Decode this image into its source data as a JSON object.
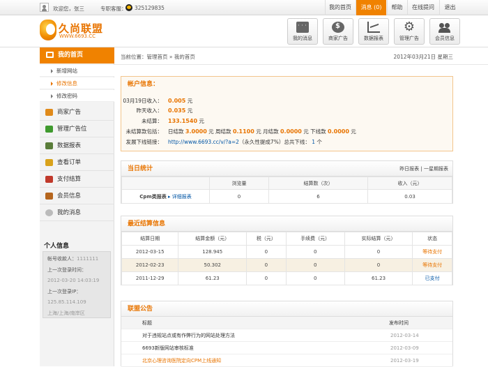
{
  "topbar": {
    "welcome": "欢迎您，张三",
    "support_label": "专职客服：",
    "support_qq": "325129835",
    "nav": [
      "我的首页",
      "消息 (0)",
      "帮助",
      "在线提问",
      "退出"
    ],
    "active_index": 1
  },
  "header": {
    "logo_name": "久尚联盟",
    "logo_url": "WWW.6693.CC",
    "buttons": [
      {
        "label": "我的消息",
        "icon": "message-icon"
      },
      {
        "label": "商家广告",
        "icon": "coin-icon"
      },
      {
        "label": "数据报表",
        "icon": "chart-icon"
      },
      {
        "label": "管理广告",
        "icon": "gear-icon"
      },
      {
        "label": "会员信息",
        "icon": "users-icon"
      }
    ]
  },
  "sidebar": {
    "head": "我的首页",
    "subitems": [
      "新增网站",
      "修改信息",
      "修改密码"
    ],
    "current_sub": 1,
    "items": [
      {
        "label": "商家广告",
        "color": "#e08a1a"
      },
      {
        "label": "管理广告位",
        "color": "#3f9a2e"
      },
      {
        "label": "数据报表",
        "color": "#5a7d3a"
      },
      {
        "label": "查看订单",
        "color": "#d9a21b"
      },
      {
        "label": "支付结算",
        "color": "#c0392b"
      },
      {
        "label": "会员信息",
        "color": "#b5651d"
      },
      {
        "label": "我的消息",
        "color": "#999999"
      }
    ],
    "info_title": "个人信息",
    "info": {
      "account_label": "帐号收款人：",
      "account_value": "1111111",
      "last_login_label": "上一次登录时间：",
      "last_login_value": "2012-03-20 14:03:19",
      "last_ip_label": "上一次登录IP：",
      "last_ip_value": "125.85.114.109",
      "location": "上海/上海/南岸区"
    }
  },
  "breadcrumb": {
    "prefix": "当前位置：",
    "home": "管理首页",
    "sep": "»",
    "current": "我的首页"
  },
  "date": "2012年03月21日  星期三",
  "account": {
    "title": "帐户信息：",
    "rows": [
      {
        "label": "03月19日收入：",
        "value": "0.005",
        "unit": "元"
      },
      {
        "label": "昨天收入：",
        "value": "0.035",
        "unit": "元"
      },
      {
        "label": "未结算：",
        "value": "133.1540",
        "unit": "元"
      }
    ],
    "settle_label": "未结算款包括：",
    "settle": [
      {
        "label": "日结款",
        "value": "3.0000",
        "unit": "元"
      },
      {
        "label": "周结款",
        "value": "0.1100",
        "unit": "元"
      },
      {
        "label": "月结款",
        "value": "0.0000",
        "unit": "元"
      },
      {
        "label": "下线款",
        "value": "0.0000",
        "unit": "元"
      }
    ],
    "link_label": "发展下线链接：",
    "link_url": "http://www.6693.cc/v/?a=2",
    "link_note": "（永久性提成7%）总共下线：",
    "link_count": "1",
    "link_unit": "个"
  },
  "today": {
    "title": "当日统计",
    "link_yesterday": "昨日报表",
    "link_week": "一星期报表",
    "headers": [
      "",
      "浏览量",
      "结算数（次）",
      "收入（元）"
    ],
    "row": {
      "type": "Cpm类报表",
      "detail": "详细报表",
      "views": "0",
      "settle": "6",
      "income": "0.03"
    }
  },
  "recent": {
    "title": "最近结算信息",
    "headers": [
      "结算日期",
      "结算金额（元）",
      "税（元）",
      "手续费（元）",
      "实际结算（元）",
      "状态"
    ],
    "rows": [
      {
        "date": "2012-03-15",
        "amount": "128.945",
        "tax": "0",
        "fee": "0",
        "actual": "0",
        "status": "等待支付"
      },
      {
        "date": "2012-02-23",
        "amount": "50.302",
        "tax": "0",
        "fee": "0",
        "actual": "0",
        "status": "等待支付"
      },
      {
        "date": "2011-12-29",
        "amount": "61.23",
        "tax": "0",
        "fee": "0",
        "actual": "61.23",
        "status": "已支付"
      }
    ]
  },
  "announce": {
    "title": "联盟公告",
    "col_title": "标题",
    "col_time": "发布时间",
    "rows": [
      {
        "title": "对于违规站点或有作弊行为的网站处理方法",
        "time": "2012-03-14"
      },
      {
        "title": "6693新版网站审核标准",
        "time": "2012-03-09"
      },
      {
        "title": "北京心理咨询医院定向CPM上线通知",
        "time": "2012-03-19"
      }
    ]
  }
}
